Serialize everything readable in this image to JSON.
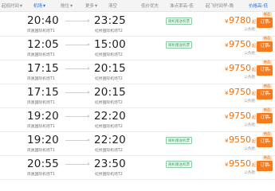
{
  "filter_bar": {
    "items": [
      "起抵时间",
      "机场",
      "舱位",
      "更多",
      "清空",
      "低价优先",
      "准点率高-低",
      "起飞时间早-晚",
      "价格高-低"
    ]
  },
  "flights": [
    {
      "dep_time": "20:40",
      "dep_airport": "凤凰国际机场T1",
      "arr_time": "23:25",
      "arr_airport": "虹桥国际机场T2",
      "promo": "随机赠送机票",
      "price": "9780",
      "discount": "公务舱",
      "book": "订票",
      "tag": "新品"
    },
    {
      "dep_time": "12:05",
      "dep_airport": "凤凰国际机场T1",
      "arr_time": "15:00",
      "arr_airport": "虹桥国际机场T2",
      "promo": "随机赠送机票",
      "price": "9750",
      "discount": "公务舱",
      "book": "订票",
      "tag": "新品"
    },
    {
      "dep_time": "17:15",
      "dep_airport": "凤凰国际机场T1",
      "arr_time": "20:15",
      "arr_airport": "虹桥国际机场T2",
      "promo": "",
      "price": "9750",
      "discount": "公务舱",
      "book": "订票",
      "tag": "新品"
    },
    {
      "dep_time": "17:15",
      "dep_airport": "凤凰国际机场T1",
      "arr_time": "20:15",
      "arr_airport": "虹桥国际机场T2",
      "promo": "",
      "price": "9750",
      "discount": "公务舱",
      "book": "订票",
      "tag": "新品"
    },
    {
      "dep_time": "19:20",
      "dep_airport": "凤凰国际机场T1",
      "arr_time": "22:20",
      "arr_airport": "虹桥国际机场T2",
      "promo": "",
      "price": "9750",
      "discount": "公务舱",
      "book": "订票",
      "tag": "新品"
    },
    {
      "dep_time": "19:20",
      "dep_airport": "凤凰国际机场T1",
      "arr_time": "22:20",
      "arr_airport": "虹桥国际机场T2",
      "promo": "随机赠送机票",
      "price": "9550",
      "discount": "公务舱",
      "book": "订票",
      "tag": "新品"
    },
    {
      "dep_time": "20:55",
      "dep_airport": "凤凰国际机场T1",
      "arr_time": "23:50",
      "arr_airport": "虹桥国际机场T2",
      "promo": "随机赠送机票",
      "price": "9550",
      "discount": "公务舱",
      "book": "订票",
      "tag": "新品"
    }
  ],
  "price_prefix": "¥",
  "price_suffix": "起",
  "colors": {
    "price": "#f0700a",
    "book_button": "#f57a1c",
    "promo": "#3a9e5f",
    "selected_filter": "#2b6fd6"
  }
}
